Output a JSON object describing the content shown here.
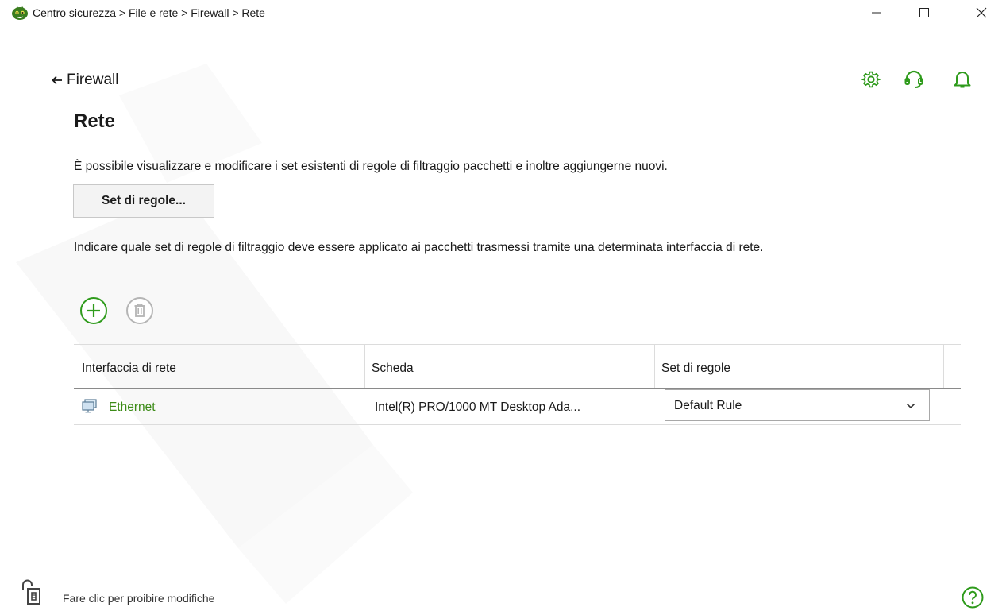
{
  "window": {
    "title": "Centro sicurezza > File e rete > Firewall > Rete",
    "controls": [
      "minimize-icon",
      "maximize-icon",
      "close-icon"
    ]
  },
  "nav": {
    "back_label": "Firewall"
  },
  "toolbar_icons": [
    "gear-icon",
    "support-headset-icon",
    "bell-icon"
  ],
  "page": {
    "title": "Rete",
    "description": "È possibile visualizzare e modificare i set esistenti di regole di filtraggio pacchetti e inoltre aggiungerne nuovi.",
    "rules_button": "Set di regole...",
    "instruction": "Indicare quale set di regole di filtraggio deve essere applicato ai pacchetti trasmessi tramite una determinata interfaccia di rete."
  },
  "actions": {
    "add_icon": "plus-icon",
    "delete_icon": "trash-icon",
    "delete_enabled": false
  },
  "table": {
    "headers": [
      "Interfaccia di rete",
      "Scheda",
      "Set di regole"
    ],
    "rows": [
      {
        "interface": "Ethernet",
        "adapter": "Intel(R) PRO/1000 MT Desktop Ada...",
        "ruleset": "Default Rule"
      }
    ]
  },
  "footer": {
    "lock_text": "Fare clic per proibire modifiche"
  },
  "colors": {
    "accent_green": "#2f9b1c",
    "link_green": "#3c8b17",
    "disabled_gray": "#b5b5b5"
  }
}
